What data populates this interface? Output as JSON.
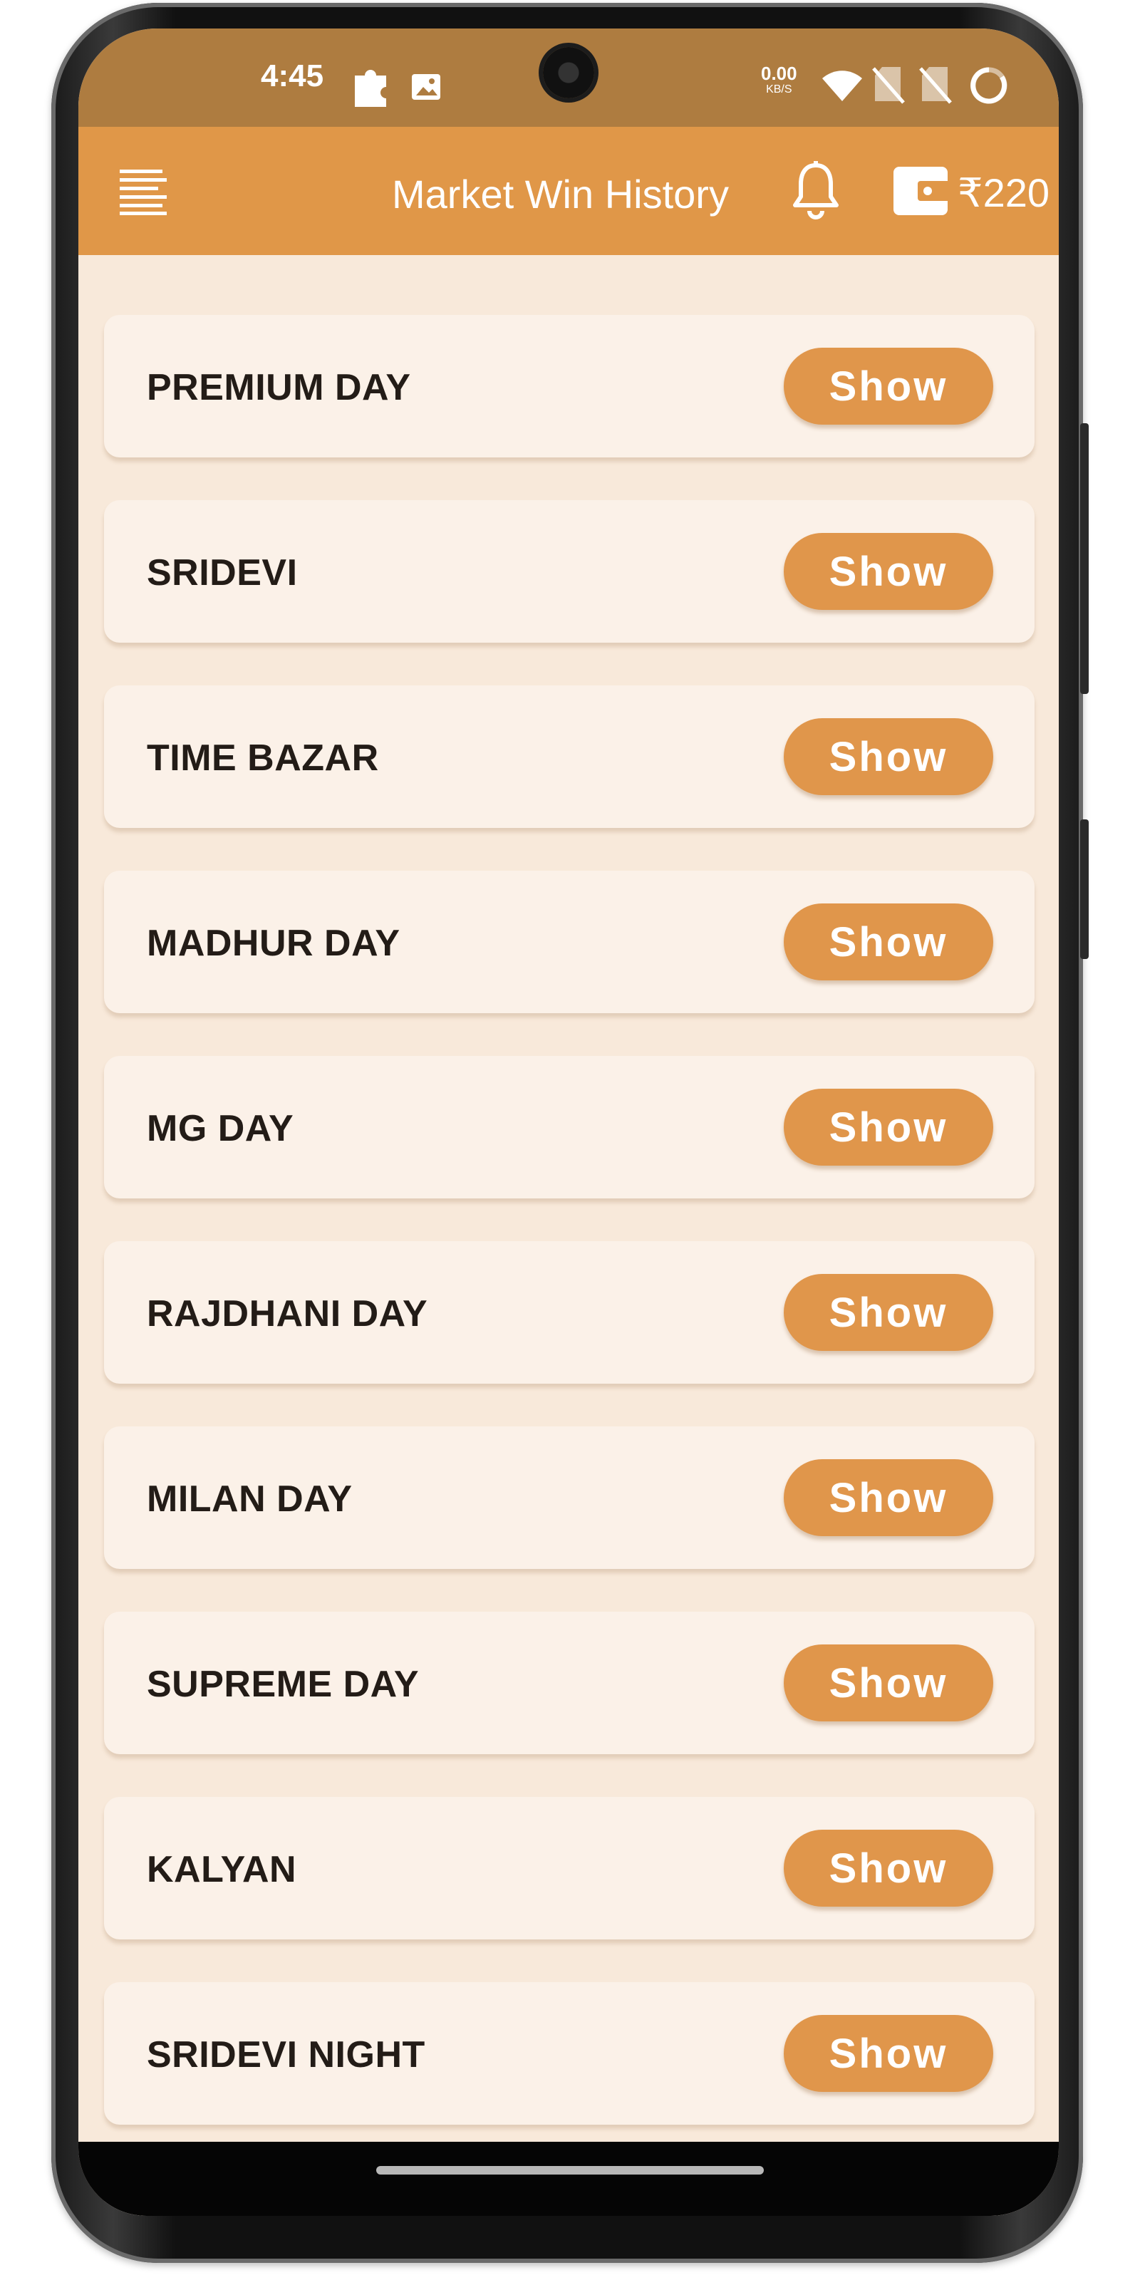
{
  "status_bar": {
    "time": "4:45",
    "net_speed_value": "0.00",
    "net_speed_unit": "KB/S"
  },
  "app_bar": {
    "title": "Market Win History",
    "balance": "₹220"
  },
  "markets": [
    {
      "name": "PREMIUM DAY",
      "button": "Show"
    },
    {
      "name": "SRIDEVI",
      "button": "Show"
    },
    {
      "name": "TIME BAZAR",
      "button": "Show"
    },
    {
      "name": "MADHUR DAY",
      "button": "Show"
    },
    {
      "name": "MG DAY",
      "button": "Show"
    },
    {
      "name": "RAJDHANI DAY",
      "button": "Show"
    },
    {
      "name": "MILAN DAY",
      "button": "Show"
    },
    {
      "name": "SUPREME DAY",
      "button": "Show"
    },
    {
      "name": "KALYAN",
      "button": "Show"
    },
    {
      "name": "SRIDEVI NIGHT",
      "button": "Show"
    }
  ],
  "icons": {
    "menu": "menu-icon",
    "notifications": "bell-icon",
    "wallet": "wallet-icon",
    "status_extension": "puzzle-icon",
    "status_gallery": "image-icon",
    "status_wifi": "wifi-icon",
    "status_sim1": "no-sim-icon",
    "status_sim2": "no-sim-icon",
    "status_battery": "battery-ring-icon"
  },
  "colors": {
    "status_bar": "#ae7c40",
    "app_bar": "#e09748",
    "background": "#f8e9da",
    "card": "#fbf1e8",
    "button": "#e0964b",
    "text_dark": "#231c17"
  }
}
